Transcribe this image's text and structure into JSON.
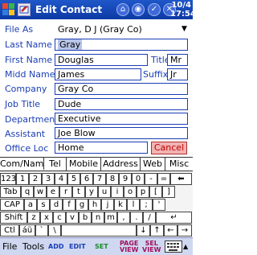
{
  "titlebar": {
    "title": "Edit Contact",
    "date": "10/4",
    "time": "17:54",
    "ok": "✓"
  },
  "form": {
    "file_as": {
      "label": "File As",
      "value": "Gray, D J (Gray Co)"
    },
    "last_name": {
      "label": "Last Name",
      "value": "Gray"
    },
    "first_name": {
      "label": "First Name",
      "value": "Douglas"
    },
    "title": {
      "label": "Title",
      "value": "Mr"
    },
    "middle_name": {
      "label": "Midd Name",
      "value": "James"
    },
    "suffix": {
      "label": "Suffix",
      "value": "Jr"
    },
    "company": {
      "label": "Company",
      "value": "Gray Co"
    },
    "job_title": {
      "label": "Job Title",
      "value": "Dude"
    },
    "department": {
      "label": "Department",
      "value": "Executive"
    },
    "assistant": {
      "label": "Assistant",
      "value": "Joe Blow"
    },
    "office_loc": {
      "label": "Office Loc",
      "value": "Home"
    },
    "cancel": "Cancel"
  },
  "tabs": [
    "Com/Nam",
    "Tel",
    "Mobile",
    "Address",
    "Web",
    "Misc"
  ],
  "keyboard": {
    "row1": [
      "123",
      "1",
      "2",
      "3",
      "4",
      "5",
      "6",
      "7",
      "8",
      "9",
      "0",
      "-",
      "=",
      "⬅"
    ],
    "row2": [
      "Tab",
      "q",
      "w",
      "e",
      "r",
      "t",
      "y",
      "u",
      "i",
      "o",
      "p",
      "[",
      "]"
    ],
    "row3": [
      "CAP",
      "a",
      "s",
      "d",
      "f",
      "g",
      "h",
      "j",
      "k",
      "l",
      ";",
      "'"
    ],
    "row4": [
      "Shift",
      "z",
      "x",
      "c",
      "v",
      "b",
      "n",
      "m",
      ",",
      ".",
      "/",
      "↵"
    ],
    "row5": [
      "Ctl",
      "áü",
      "`",
      "\\",
      "↓",
      "↑",
      "←",
      "→"
    ]
  },
  "bottombar": {
    "file": "File",
    "tools": "Tools",
    "add": "ADD",
    "edit": "EDIT",
    "set": "SET",
    "page_view": [
      "PAGE",
      "VIEW"
    ],
    "sel_view": [
      "SEL",
      "VIEW"
    ]
  }
}
